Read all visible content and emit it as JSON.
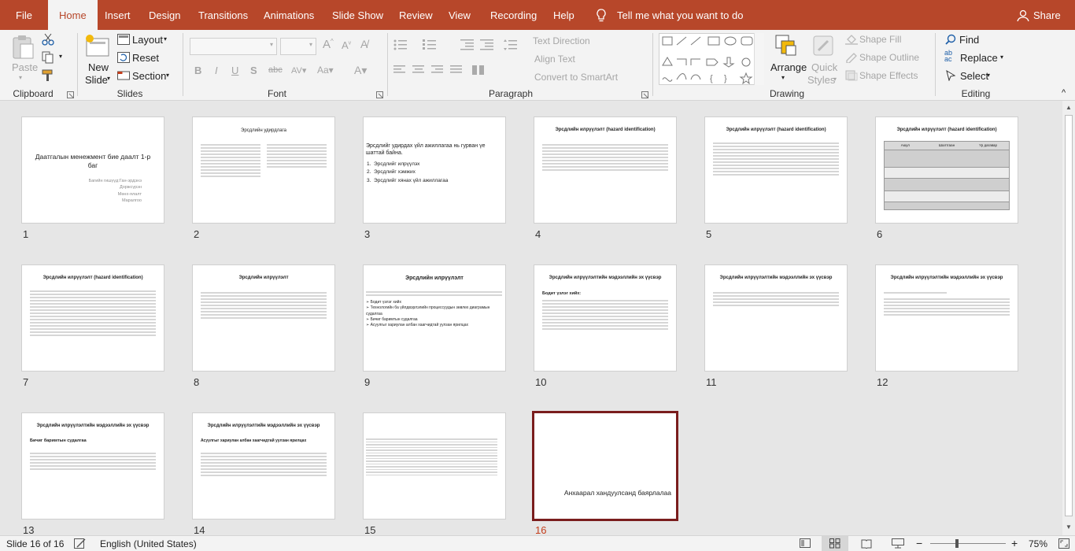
{
  "menu": {
    "tabs": [
      "File",
      "Home",
      "Insert",
      "Design",
      "Transitions",
      "Animations",
      "Slide Show",
      "Review",
      "View",
      "Recording",
      "Help"
    ],
    "tell_me": "Tell me what you want to do",
    "share": "Share"
  },
  "ribbon": {
    "clipboard": {
      "label": "Clipboard",
      "paste": "Paste"
    },
    "slides": {
      "label": "Slides",
      "new_slide_1": "New",
      "new_slide_2": "Slide",
      "layout": "Layout",
      "reset": "Reset",
      "section": "Section"
    },
    "font": {
      "label": "Font"
    },
    "paragraph": {
      "label": "Paragraph",
      "text_direction": "Text Direction",
      "align_text": "Align Text",
      "convert_smartart": "Convert to SmartArt"
    },
    "drawing": {
      "label": "Drawing",
      "arrange": "Arrange",
      "quick_styles_1": "Quick",
      "quick_styles_2": "Styles",
      "shape_fill": "Shape Fill",
      "shape_outline": "Shape Outline",
      "shape_effects": "Shape Effects"
    },
    "editing": {
      "label": "Editing",
      "find": "Find",
      "replace": "Replace",
      "select": "Select"
    }
  },
  "slides": [
    {
      "n": "1",
      "title": "Даатгалын менежмент бие даалт 1-р баг",
      "authors": [
        "Багийн гишүүд:Ган-эрдэнэ",
        "Доржсүрэн",
        "Мөнх-ялалт",
        "Маралгоо"
      ]
    },
    {
      "n": "2",
      "title": "Эрсдлийн удирдлага"
    },
    {
      "n": "3",
      "title": "Эрсдлийг удирдах үйл ажиллагаа нь гурван үе шаттай байна.",
      "items": [
        "Эрсдлийг илрүүлэх",
        "Эрсдлийг хэмжих",
        "Эрсдлийг хянах үйл ажиллагаа"
      ]
    },
    {
      "n": "4",
      "title": "Эрсдлийн илрүүлэлт (hazard identification)"
    },
    {
      "n": "5",
      "title": "Эрсдлийн илрүүлэлт (hazard identification)"
    },
    {
      "n": "6",
      "title": "Эрсдлийн илрүүлэлт (hazard identification)",
      "table_head": [
        "Аюул",
        "Шалтгаан",
        "Үр дагавар"
      ]
    },
    {
      "n": "7",
      "title": "Эрсдлийн илрүүлэлт (hazard identification)"
    },
    {
      "n": "8",
      "title": "Эрсдлийн илрүүлэлт"
    },
    {
      "n": "9",
      "title": "Эрсдлийн илрүүлэлт",
      "items": [
        "Бодит үзлэг хийх",
        "Технологийн ба үйлдвэрлэлийн процессуудын зөвлөх диаграмын судалгаа",
        "Бичиг баримтын судалгаа",
        "Асуулгыг хариулан албан хаагчидтай уулзан ярилцах"
      ]
    },
    {
      "n": "10",
      "title": "Эрсдлийн илрүүлэлтийн мэдээллийн эх үүсвэр",
      "sub": "Бодит үзлэг хийх:"
    },
    {
      "n": "11",
      "title": "Эрсдлийн илрүүлэлтийн мэдээллийн эх үүсвэр"
    },
    {
      "n": "12",
      "title": "Эрсдлийн илрүүлэлтийн мэдээллийн эх үүсвэр"
    },
    {
      "n": "13",
      "title": "Эрсдлийн илрүүлэлтийн мэдээллийн эх үүсвэр",
      "sub": "Бичиг баримтын судалгаа"
    },
    {
      "n": "14",
      "title": "Эрсдлийн илрүүлэлтийн мэдээллийн эх үүсвэр",
      "sub": "Асуулгыг хариулан албан хаагчидтай уулзан ярилцах"
    },
    {
      "n": "15"
    },
    {
      "n": "16",
      "text": "Анхаарал хандуулсанд баярлалаа"
    }
  ],
  "status": {
    "slide_of": "Slide 16 of 16",
    "language": "English (United States)",
    "zoom": "75%"
  }
}
